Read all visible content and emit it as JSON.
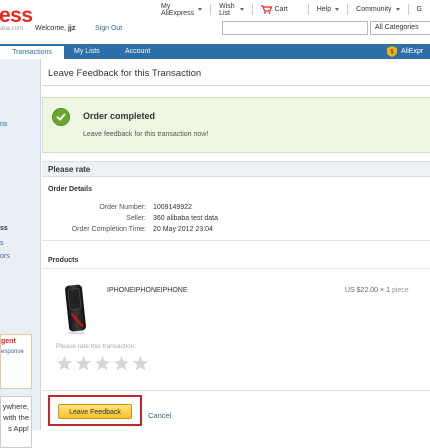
{
  "header": {
    "logo_text": "ess",
    "logo_sub": "aba.com",
    "welcome_prefix": "Welcome,",
    "username": "jjz",
    "sign_out": "Sign Out",
    "nav": {
      "my_aliexpress": "My AliExpress",
      "wish_list": "Wish List",
      "cart": "Cart",
      "help": "Help",
      "community": "Community",
      "extra": "G"
    },
    "search": {
      "value": "",
      "placeholder": ""
    },
    "category": "All Categories"
  },
  "tabs": {
    "transactions": "Transactions",
    "my_lists": "My Lists",
    "account": "Account",
    "aliexpress": "AliExpr"
  },
  "sidebar": {
    "item_ns": "ns",
    "item_ss": "ss",
    "item_s": "s",
    "item_ors": "ors",
    "agent": "gent",
    "response": "esponse",
    "app_line1": "ywhere,",
    "app_line2": "with the",
    "app_line3": "s App!"
  },
  "main": {
    "title": "Leave Feedback for this Transaction",
    "success": {
      "title": "Order completed",
      "subtitle": "Leave feedback for this transaction now!"
    },
    "rate_title": "Please rate",
    "order_details": {
      "label": "Order Details",
      "rows": [
        {
          "label": "Order Number:",
          "value": "1009149922"
        },
        {
          "label": "Seller:",
          "value": "360 alibaba test data"
        },
        {
          "label": "Order Completion Time:",
          "value": "20 May 2012 23:04"
        }
      ]
    },
    "products": {
      "label": "Products",
      "name": "IPHONEIPHONEIPHONE",
      "price": "US $22.00",
      "quantity": "× 1",
      "unit": "piece"
    },
    "rate_prompt": "Please rate this transaction:",
    "rating": 0,
    "rating_max": 5,
    "leave_feedback_button": "Leave Feedback",
    "cancel": "Cancel"
  },
  "colors": {
    "brand_red": "#e8281e",
    "nav_blue": "#2c6ea6",
    "success_green": "#6aa72d",
    "button_yellow": "#f6c22c",
    "highlight_red": "#c0282c"
  }
}
